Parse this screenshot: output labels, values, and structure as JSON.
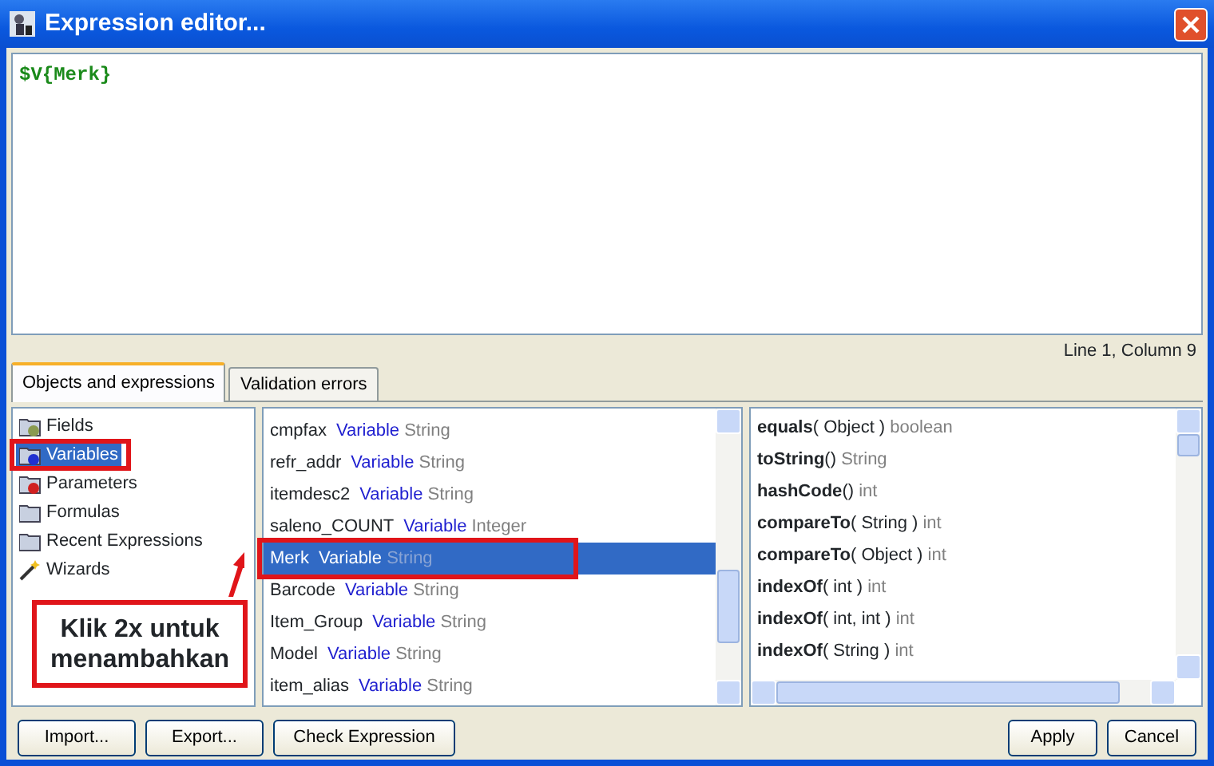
{
  "window": {
    "title": "Expression editor..."
  },
  "editor": {
    "value": "$V{Merk}"
  },
  "status": "Line 1, Column 9",
  "tabs": [
    {
      "label": "Objects and expressions",
      "selected": true
    },
    {
      "label": "Validation errors",
      "selected": false
    }
  ],
  "categories": [
    {
      "label": "Fields",
      "kind": "fields",
      "selected": false
    },
    {
      "label": "Variables",
      "kind": "variables",
      "selected": true
    },
    {
      "label": "Parameters",
      "kind": "parameters",
      "selected": false
    },
    {
      "label": "Formulas",
      "kind": "folder",
      "selected": false
    },
    {
      "label": "Recent Expressions",
      "kind": "folder",
      "selected": false
    },
    {
      "label": "Wizards",
      "kind": "wizard",
      "selected": false
    }
  ],
  "objects": [
    {
      "name": "cmpfax",
      "kind": "Variable",
      "type": "String",
      "selected": false
    },
    {
      "name": "refr_addr",
      "kind": "Variable",
      "type": "String",
      "selected": false
    },
    {
      "name": "itemdesc2",
      "kind": "Variable",
      "type": "String",
      "selected": false
    },
    {
      "name": "saleno_COUNT",
      "kind": "Variable",
      "type": "Integer",
      "selected": false
    },
    {
      "name": "Merk",
      "kind": "Variable",
      "type": "String",
      "selected": true
    },
    {
      "name": "Barcode",
      "kind": "Variable",
      "type": "String",
      "selected": false
    },
    {
      "name": "Item_Group",
      "kind": "Variable",
      "type": "String",
      "selected": false
    },
    {
      "name": "Model",
      "kind": "Variable",
      "type": "String",
      "selected": false
    },
    {
      "name": "item_alias",
      "kind": "Variable",
      "type": "String",
      "selected": false
    }
  ],
  "methods": [
    {
      "name": "equals",
      "args": "( Object )",
      "returns": "boolean"
    },
    {
      "name": "toString",
      "args": "()",
      "returns": "String"
    },
    {
      "name": "hashCode",
      "args": "()",
      "returns": "int"
    },
    {
      "name": "compareTo",
      "args": "( String )",
      "returns": "int"
    },
    {
      "name": "compareTo",
      "args": "( Object )",
      "returns": "int"
    },
    {
      "name": "indexOf",
      "args": "( int )",
      "returns": "int"
    },
    {
      "name": "indexOf",
      "args": "( int, int )",
      "returns": "int"
    },
    {
      "name": "indexOf",
      "args": "( String )",
      "returns": "int"
    }
  ],
  "left_buttons": [
    "Import...",
    "Export...",
    "Check Expression"
  ],
  "right_buttons": [
    "Apply",
    "Cancel"
  ],
  "callout": {
    "text": "Klik 2x untuk menambahkan"
  }
}
